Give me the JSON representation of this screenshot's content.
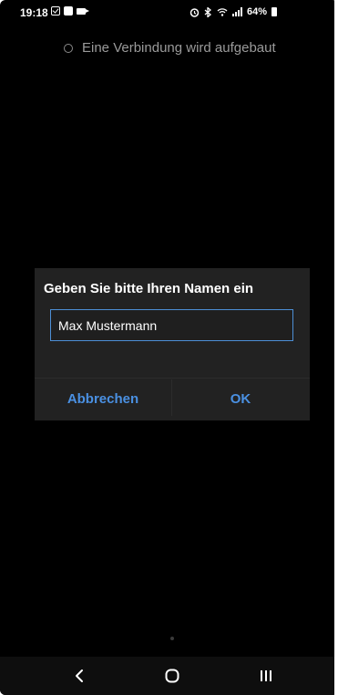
{
  "status_bar": {
    "time": "19:18",
    "battery_text": "64%",
    "left_icons": [
      "checkbox-notification-icon",
      "app-notification-icon",
      "video-camera-icon"
    ],
    "right_icons": [
      "alarm-icon",
      "bluetooth-icon",
      "wifi-icon",
      "signal-icon",
      "battery-icon"
    ]
  },
  "connection": {
    "status_text": "Eine Verbindung wird aufgebaut"
  },
  "dialog": {
    "title": "Geben Sie bitte Ihren Namen ein",
    "name_value": "Max Mustermann",
    "cancel_label": "Abbrechen",
    "ok_label": "OK"
  },
  "nav_bar": {
    "icons": [
      "back-icon",
      "home-icon",
      "recent-apps-icon"
    ]
  },
  "colors": {
    "background": "#000000",
    "dialog_background": "#222222",
    "accent": "#4a90e2",
    "input_border": "#4d8fd6",
    "status_text": "#9a9a9a"
  }
}
